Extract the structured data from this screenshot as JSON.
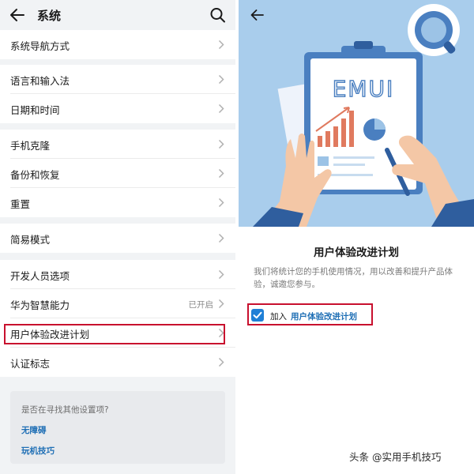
{
  "left_panel": {
    "header": {
      "title": "系统",
      "back_icon": "arrow-left-icon",
      "search_icon": "search-icon"
    },
    "rows": [
      {
        "label": "系统导航方式",
        "status": ""
      },
      {
        "label": "语言和输入法",
        "status": ""
      },
      {
        "label": "日期和时间",
        "status": ""
      },
      {
        "label": "手机克隆",
        "status": ""
      },
      {
        "label": "备份和恢复",
        "status": ""
      },
      {
        "label": "重置",
        "status": ""
      },
      {
        "label": "简易模式",
        "status": ""
      },
      {
        "label": "开发人员选项",
        "status": ""
      },
      {
        "label": "华为智慧能力",
        "status": "已开启"
      },
      {
        "label": "用户体验改进计划",
        "status": ""
      },
      {
        "label": "认证标志",
        "status": ""
      }
    ],
    "suggestions": {
      "title": "是否在寻找其他设置项?",
      "links": [
        "无障碍",
        "玩机技巧"
      ]
    }
  },
  "right_panel": {
    "illustration": {
      "logo_text": "EMUI",
      "background_color": "#a9cdec"
    },
    "title": "用户体验改进计划",
    "description": "我们将统计您的手机使用情况，用以改善和提升产品体验，诚邀您参与。",
    "join_checkbox": {
      "checked": true,
      "prefix": "加入",
      "link_text": "用户体验改进计划"
    }
  },
  "watermark": "头条 @实用手机技巧",
  "colors": {
    "accent_blue": "#1f7fd6",
    "highlight_red": "#c8102e",
    "illustration_bg": "#a9cdec"
  }
}
